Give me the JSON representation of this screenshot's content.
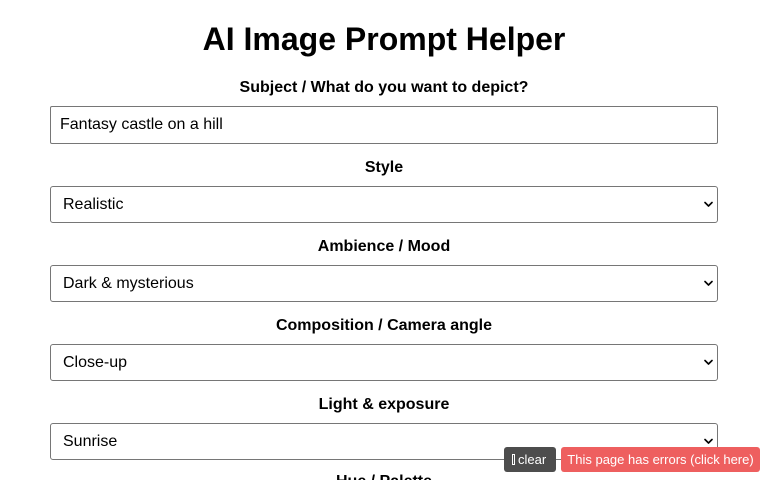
{
  "page": {
    "title": "AI Image Prompt Helper"
  },
  "form": {
    "subject": {
      "label": "Subject / What do you want to depict?",
      "value": "Fantasy castle on a hill"
    },
    "style": {
      "label": "Style",
      "selected": "Realistic"
    },
    "ambience": {
      "label": "Ambience / Mood",
      "selected": "Dark & mysterious"
    },
    "composition": {
      "label": "Composition / Camera angle",
      "selected": "Close-up"
    },
    "light": {
      "label": "Light & exposure",
      "selected": "Sunrise"
    },
    "hue": {
      "label": "Hue / Palette"
    }
  },
  "overlay": {
    "clear_label": "clear",
    "errors_label": "This page has errors (click here)"
  },
  "colors": {
    "clear_bg": "#4d4d4d",
    "errors_bg": "#ee5f5f",
    "border": "#767676"
  }
}
